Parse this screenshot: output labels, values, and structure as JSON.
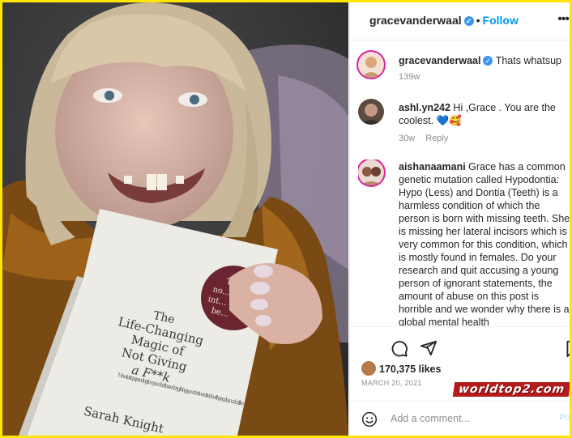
{
  "header": {
    "username": "gracevanderwaal",
    "follow_label": "Follow",
    "more_icon": "more-horizontal-icon"
  },
  "caption": {
    "username": "gracevanderwaal",
    "text": "Thats whatsup",
    "time": "139w"
  },
  "comments": [
    {
      "username": "ashl.yn242",
      "text": "Hi ,Grace . You are the coolest. 💙🥰",
      "time": "30w",
      "reply_label": "Reply"
    },
    {
      "username": "aishanaamani",
      "text": "Grace has a common genetic mutation called Hypodontia: Hypo (Less) and Dontia (Teeth) is a harmless condition of which the person is born with missing teeth. She is missing her lateral incisors which is very common for this condition, which is mostly found in females. Do your research and quit accusing a young person of ignorant statements, the amount of abuse on this post is horrible and we wonder why there is a global mental health"
    }
  ],
  "likes": "170,375 likes",
  "date": "MARCH 20, 2021",
  "add_comment": {
    "placeholder": "Add a comment...",
    "post_label": "Po"
  },
  "watermark": "worldtop2.com",
  "book": {
    "title_line1": "The",
    "title_line2": "Life-Changing",
    "title_line3": "Magic of",
    "title_line4": "Not Giving",
    "title_line5": "a F**k",
    "subtitle": "How to stop spending time you don't have doing things you don't want to do with people you don't like",
    "author": "Sarah Knight",
    "sticker_l1": "The",
    "sticker_l2": "no...",
    "sticker_l3": "int...",
    "sticker_l4": "be..."
  },
  "colors": {
    "border": "#ffe600",
    "link": "#0095f6",
    "verified": "#3897f0",
    "muted": "#8e8e8e"
  }
}
